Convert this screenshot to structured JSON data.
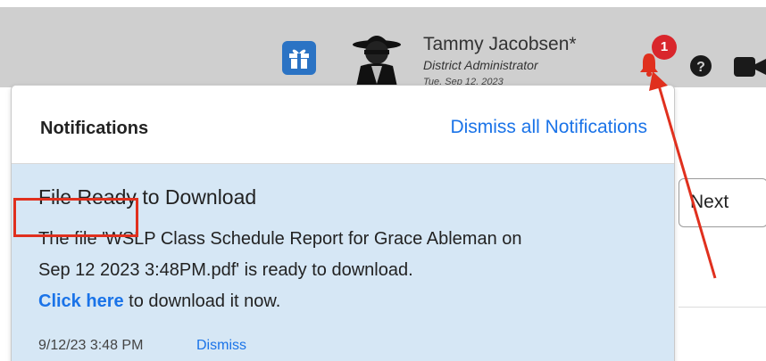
{
  "header": {
    "user_name": "Tammy Jacobsen*",
    "user_role": "District Administrator",
    "user_date": "Tue, Sep 12, 2023",
    "notification_count": "1",
    "icons": [
      "gift-icon",
      "spy-avatar-icon",
      "bell-icon",
      "help-icon",
      "video-icon"
    ]
  },
  "background": {
    "next_label": "Next"
  },
  "notifications": {
    "title": "Notifications",
    "dismiss_all_label": "Dismiss all Notifications",
    "items": [
      {
        "title": "File Ready to Download",
        "body_line1": "The file 'WSLP Class Schedule Report for Grace Ableman on",
        "body_line2": "Sep 12 2023 3:48PM.pdf' is ready to download.",
        "link_label": "Click here",
        "link_suffix": " to download it now.",
        "timestamp": "9/12/23 3:48 PM",
        "dismiss_label": "Dismiss"
      }
    ]
  },
  "colors": {
    "link": "#1a73e8",
    "notice_bg": "#d6e7f5",
    "badge": "#d9262c",
    "annotation": "#e0301e",
    "header_bg": "#cfcfcf"
  }
}
